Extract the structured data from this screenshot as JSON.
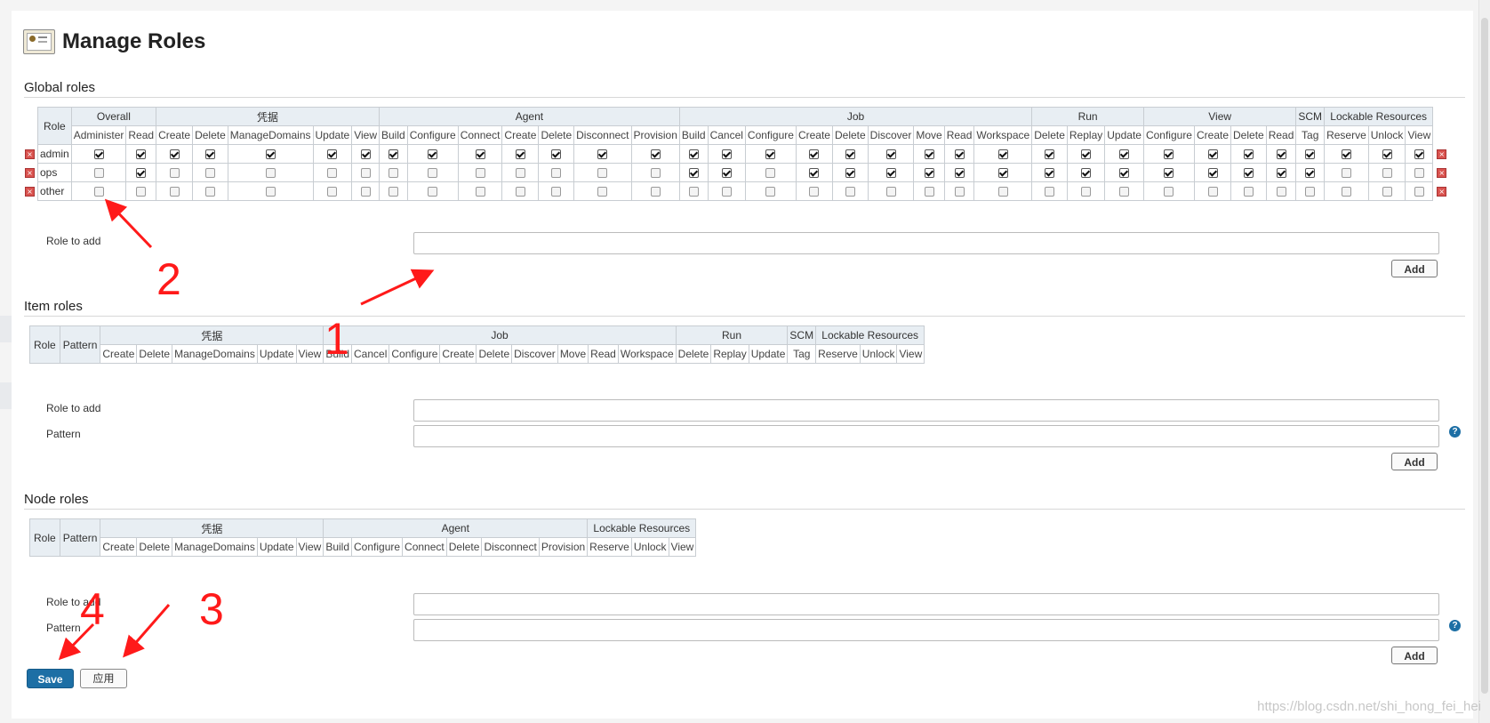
{
  "page": {
    "title": "Manage Roles"
  },
  "global": {
    "title": "Global roles",
    "role_header": "Role",
    "groups": [
      {
        "name": "Overall",
        "perms": [
          "Administer",
          "Read"
        ]
      },
      {
        "name": "凭据",
        "perms": [
          "Create",
          "Delete",
          "ManageDomains",
          "Update",
          "View"
        ]
      },
      {
        "name": "Agent",
        "perms": [
          "Build",
          "Configure",
          "Connect",
          "Create",
          "Delete",
          "Disconnect",
          "Provision"
        ]
      },
      {
        "name": "Job",
        "perms": [
          "Build",
          "Cancel",
          "Configure",
          "Create",
          "Delete",
          "Discover",
          "Move",
          "Read",
          "Workspace"
        ]
      },
      {
        "name": "Run",
        "perms": [
          "Delete",
          "Replay",
          "Update"
        ]
      },
      {
        "name": "View",
        "perms": [
          "Configure",
          "Create",
          "Delete",
          "Read"
        ]
      },
      {
        "name": "SCM",
        "perms": [
          "Tag"
        ]
      },
      {
        "name": "Lockable Resources",
        "perms": [
          "Reserve",
          "Unlock",
          "View"
        ]
      }
    ],
    "roles": [
      {
        "name": "admin",
        "checks": [
          1,
          1,
          1,
          1,
          1,
          1,
          1,
          1,
          1,
          1,
          1,
          1,
          1,
          1,
          1,
          1,
          1,
          1,
          1,
          1,
          1,
          1,
          1,
          1,
          1,
          1,
          1,
          1,
          1,
          1,
          1,
          1,
          1,
          1
        ]
      },
      {
        "name": "ops",
        "checks": [
          0,
          1,
          0,
          0,
          0,
          0,
          0,
          0,
          0,
          0,
          0,
          0,
          0,
          0,
          1,
          1,
          0,
          1,
          1,
          1,
          1,
          1,
          1,
          1,
          1,
          1,
          1,
          1,
          1,
          1,
          1,
          0,
          0,
          0
        ]
      },
      {
        "name": "other",
        "checks": [
          0,
          0,
          0,
          0,
          0,
          0,
          0,
          0,
          0,
          0,
          0,
          0,
          0,
          0,
          0,
          0,
          0,
          0,
          0,
          0,
          0,
          0,
          0,
          0,
          0,
          0,
          0,
          0,
          0,
          0,
          0,
          0,
          0,
          0
        ]
      }
    ],
    "role_to_add_label": "Role to add",
    "add_label": "Add"
  },
  "item": {
    "title": "Item roles",
    "role_header": "Role",
    "pattern_header": "Pattern",
    "groups": [
      {
        "name": "凭据",
        "perms": [
          "Create",
          "Delete",
          "ManageDomains",
          "Update",
          "View"
        ]
      },
      {
        "name": "Job",
        "perms": [
          "Build",
          "Cancel",
          "Configure",
          "Create",
          "Delete",
          "Discover",
          "Move",
          "Read",
          "Workspace"
        ]
      },
      {
        "name": "Run",
        "perms": [
          "Delete",
          "Replay",
          "Update"
        ]
      },
      {
        "name": "SCM",
        "perms": [
          "Tag"
        ]
      },
      {
        "name": "Lockable Resources",
        "perms": [
          "Reserve",
          "Unlock",
          "View"
        ]
      }
    ],
    "role_to_add_label": "Role to add",
    "pattern_label": "Pattern",
    "add_label": "Add"
  },
  "node": {
    "title": "Node roles",
    "role_header": "Role",
    "pattern_header": "Pattern",
    "groups": [
      {
        "name": "凭据",
        "perms": [
          "Create",
          "Delete",
          "ManageDomains",
          "Update",
          "View"
        ]
      },
      {
        "name": "Agent",
        "perms": [
          "Build",
          "Configure",
          "Connect",
          "Delete",
          "Disconnect",
          "Provision"
        ]
      },
      {
        "name": "Lockable Resources",
        "perms": [
          "Reserve",
          "Unlock",
          "View"
        ]
      }
    ],
    "role_to_add_label": "Role to add",
    "pattern_label": "Pattern",
    "add_label": "Add"
  },
  "footer": {
    "save_label": "Save",
    "apply_label": "应用"
  },
  "annotations": [
    "1",
    "2",
    "3",
    "4"
  ],
  "watermark": "https://blog.csdn.net/shi_hong_fei_hei",
  "help_glyph": "?",
  "colors": {
    "primary_button": "#1d6fa5",
    "annotation_red": "#ff1a1a",
    "delete_icon": "#d9534f"
  }
}
